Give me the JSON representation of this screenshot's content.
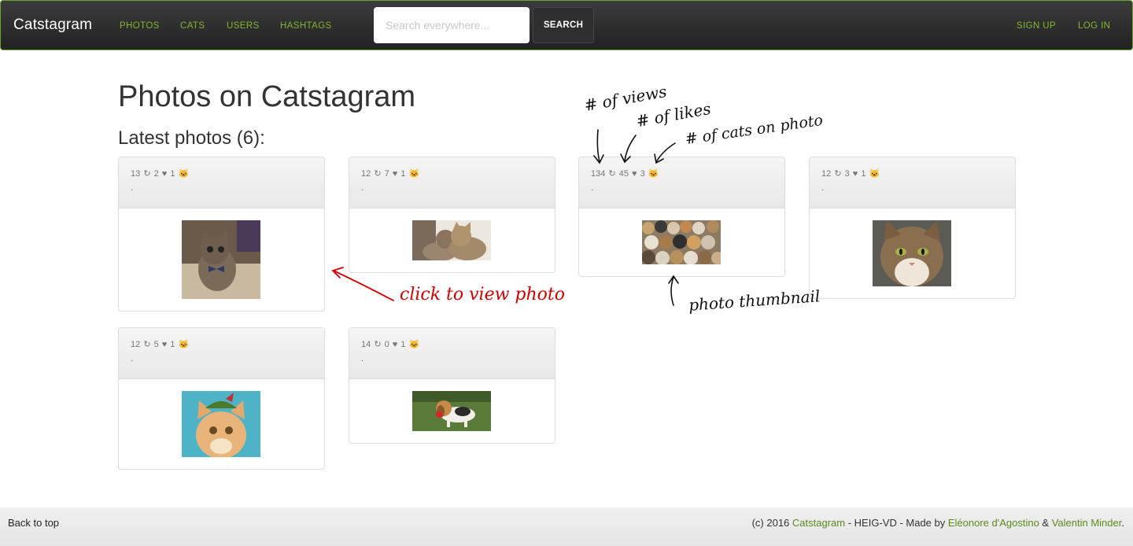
{
  "nav": {
    "brand": "Catstagram",
    "links": [
      "PHOTOS",
      "CATS",
      "USERS",
      "HASHTAGS"
    ],
    "search_placeholder": "Search everywhere...",
    "search_button": "SEARCH",
    "signup": "SIGN UP",
    "login": "LOG IN"
  },
  "page": {
    "title": "Photos on Catstagram",
    "subtitle": "Latest photos (6):"
  },
  "photos": [
    {
      "views": "13",
      "likes": "2",
      "cats": "1",
      "caption": "."
    },
    {
      "views": "12",
      "likes": "7",
      "cats": "1",
      "caption": "."
    },
    {
      "views": "134",
      "likes": "45",
      "cats": "3",
      "caption": "."
    },
    {
      "views": "12",
      "likes": "3",
      "cats": "1",
      "caption": "."
    },
    {
      "views": "12",
      "likes": "5",
      "cats": "1",
      "caption": "."
    },
    {
      "views": "14",
      "likes": "0",
      "cats": "1",
      "caption": "."
    }
  ],
  "annotations": {
    "views": "# of views",
    "likes": "# of likes",
    "cats": "# of cats on photo",
    "click": "click to view photo",
    "thumbnail": "photo thumbnail"
  },
  "footer": {
    "back_to_top": "Back to top",
    "prefix": "(c) 2016 ",
    "brand": "Catstagram",
    "middle": " - HEIG-VD - Made by ",
    "author1": "Eléonore d'Agostino",
    "amp": " & ",
    "author2": "Valentin Minder",
    "end": "."
  },
  "colors": {
    "accent": "#7fb82e",
    "navbar": "#2a2a2a",
    "annotation_red": "#d40000"
  }
}
